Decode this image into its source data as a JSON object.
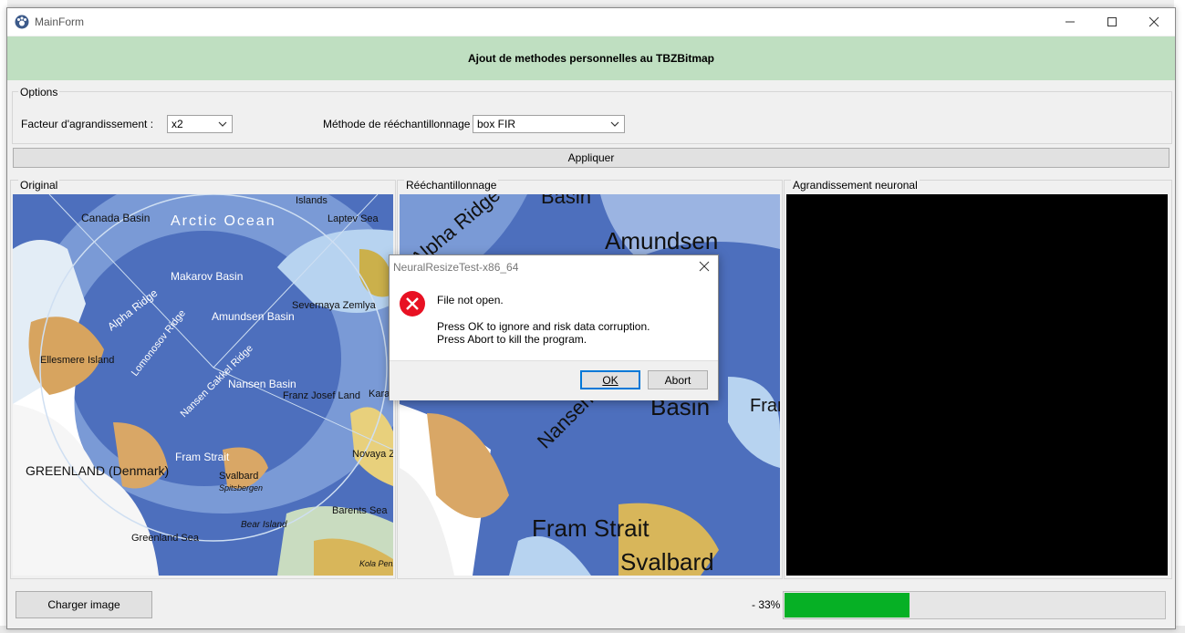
{
  "window": {
    "title": "MainForm"
  },
  "banner": {
    "text": "Ajout de methodes personnelles au TBZBitmap"
  },
  "options": {
    "group_label": "Options",
    "factor_label": "Facteur d'agrandissement :",
    "factor_value": "x2",
    "method_label": "Méthode de rééchantillonnage",
    "method_value": "box FIR"
  },
  "apply_button": "Appliquer",
  "panels": {
    "original": "Original",
    "resampled": "Rééchantillonnage",
    "neural": "Agrandissement neuronal"
  },
  "map_original": {
    "labels": [
      "Canada Basin",
      "Arctic Ocean",
      "Islands",
      "Laptev Sea",
      "Makarov Basin",
      "Alpha Ridge",
      "Amundsen Basin",
      "Severnaya Zemlya",
      "Lomonosov Ridge",
      "Nansen Gakkel Ridge",
      "Nansen Basin",
      "Ellesmere Island",
      "Franz Josef Land",
      "Kara Sea",
      "GREENLAND (Denmark)",
      "Fram Strait",
      "Svalbard",
      "Spitsbergen",
      "Novaya Zemlya",
      "Bear Island",
      "Barents Sea",
      "Greenland Sea",
      "Kola Peninsula"
    ]
  },
  "map_resampled": {
    "labels": [
      "Basin",
      "Alpha Ridge",
      "Amundsen",
      "Nansen",
      "Basin",
      "Fram Strait",
      "Svalbard",
      "Franz Josef Land"
    ]
  },
  "dialog": {
    "title": "NeuralResizeTest-x86_64",
    "message_line1": "File not open.",
    "message_line2": "Press OK to ignore and risk data corruption.",
    "message_line3": "Press Abort to kill the program.",
    "ok_label": "OK",
    "abort_label": "Abort"
  },
  "bottom": {
    "load_button": "Charger image",
    "progress_text": "- 33%",
    "progress_value": 33
  },
  "colors": {
    "banner": "#bfdfc1",
    "progress": "#06b025",
    "error": "#e81123"
  }
}
